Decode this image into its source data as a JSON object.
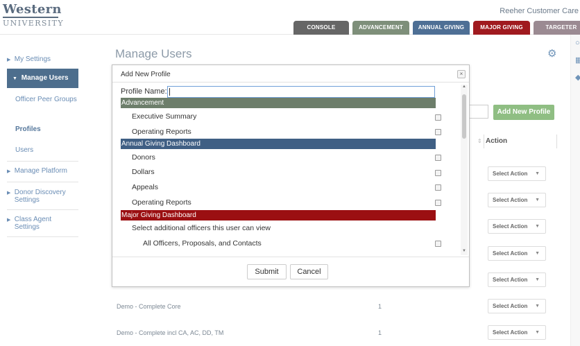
{
  "brand": {
    "logo_line1": "Western",
    "logo_line2": "UNIVERSITY",
    "org": "Reeher Customer Care"
  },
  "tabs": [
    "CONSOLE",
    "ADVANCEMENT",
    "ANNUAL GIVING",
    "MAJOR GIVING",
    "TARGETER"
  ],
  "sidebar": {
    "my_settings": "My Settings",
    "manage_users": "Manage Users",
    "officer_peer_groups": "Officer Peer Groups",
    "profiles": "Profiles",
    "users": "Users",
    "manage_platform": "Manage Platform",
    "donor_discovery": "Donor Discovery Settings",
    "class_agent": "Class Agent Settings"
  },
  "page": {
    "title": "Manage Users",
    "add_profile_button": "Add New Profile",
    "action_header": "Action",
    "select_action": "Select Action",
    "rows": [
      {
        "name": "Demo - Complete Core",
        "count": "1"
      },
      {
        "name": "Demo - Complete incl CA, AC, DD, TM",
        "count": "1"
      }
    ]
  },
  "modal": {
    "title": "Add New Profile",
    "close": "×",
    "profile_name_label": "Profile Name:",
    "profile_name_value": "",
    "sections": {
      "advancement": {
        "header": "Advancement",
        "options": [
          "Executive Summary",
          "Operating Reports"
        ]
      },
      "annual_giving": {
        "header": "Annual Giving Dashboard",
        "options": [
          "Donors",
          "Dollars",
          "Appeals",
          "Operating Reports"
        ]
      },
      "major_giving": {
        "header": "Major Giving Dashboard",
        "options": [
          "Select additional officers this user can view",
          "All Officers, Proposals, and Contacts"
        ]
      }
    },
    "submit": "Submit",
    "cancel": "Cancel"
  },
  "colors": {
    "advancement": "#6d7e6b",
    "annual_giving": "#3f5f84",
    "major_giving": "#9b0f12",
    "sidebar_active": "#4d6e8d",
    "add_button": "#8fbe83"
  }
}
